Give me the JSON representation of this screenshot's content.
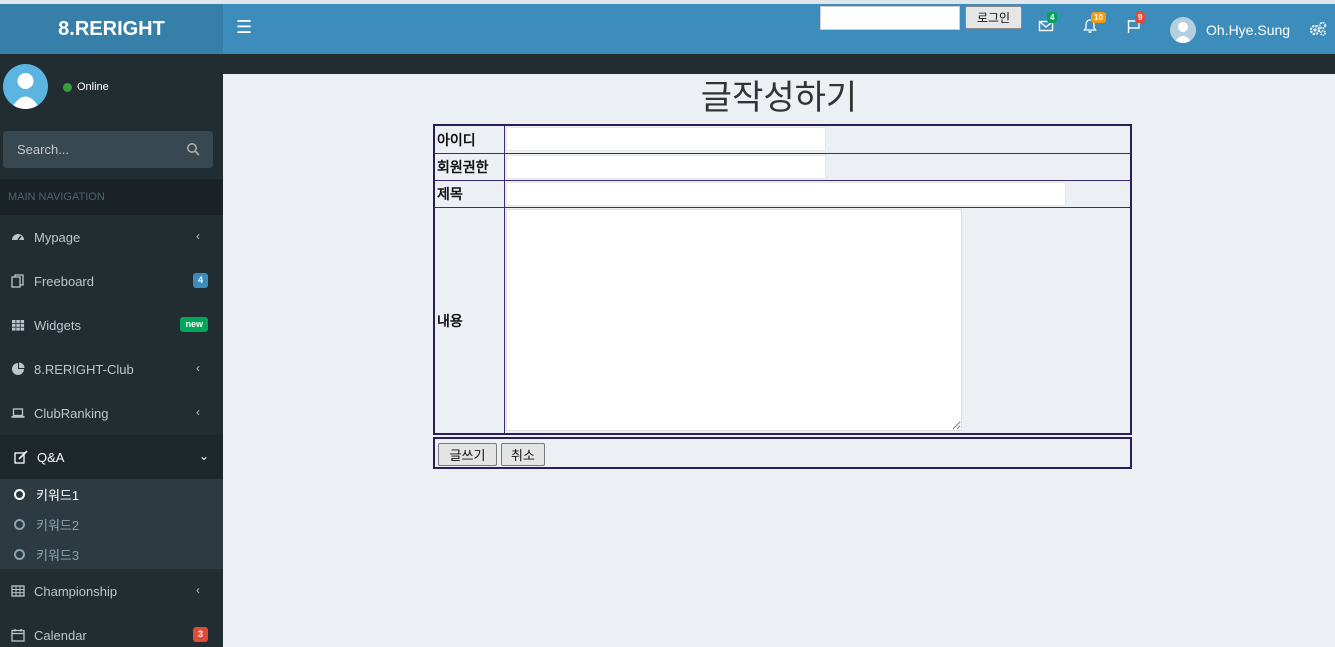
{
  "header": {
    "logo": "8.RERIGHT",
    "search_placeholder": "",
    "login_label": "로그인",
    "mail_count": "4",
    "notif_count": "10",
    "flag_count": "9",
    "user_name": "Oh.Hye.Sung",
    "colors": {
      "header_bg": "#3c8dbc",
      "logo_bg": "#367fa9",
      "mail_badge": "#00a65a",
      "notif_badge": "#f39c12",
      "flag_badge": "#dd4b39"
    }
  },
  "sidebar": {
    "status": "Online",
    "search_placeholder": "Search...",
    "nav_header": "MAIN NAVIGATION",
    "items": [
      {
        "label": "Mypage",
        "icon": "dashboard-icon",
        "chevron": "‹"
      },
      {
        "label": "Freeboard",
        "icon": "files-icon",
        "badge": "4",
        "badge_color": "#3c8dbc"
      },
      {
        "label": "Widgets",
        "icon": "grid-icon",
        "badge": "new",
        "badge_color": "#00a65a"
      },
      {
        "label": "8.RERIGHT-Club",
        "icon": "pie-chart-icon",
        "chevron": "‹"
      },
      {
        "label": "ClubRanking",
        "icon": "laptop-icon",
        "chevron": "‹"
      },
      {
        "label": "Q&A",
        "icon": "edit-icon",
        "chevron": "⌄"
      },
      {
        "label": "Championship",
        "icon": "table-icon",
        "chevron": "‹"
      },
      {
        "label": "Calendar",
        "icon": "calendar-icon",
        "badge": "3",
        "badge_color": "#dd4b39"
      }
    ],
    "submenu": [
      "키워드1",
      "키워드2",
      "키워드3"
    ]
  },
  "main": {
    "title": "글작성하기",
    "form": {
      "id_label": "아이디",
      "auth_label": "회원권한",
      "subject_label": "제목",
      "content_label": "내용"
    },
    "buttons": {
      "submit": "글쓰기",
      "cancel": "취소"
    }
  }
}
